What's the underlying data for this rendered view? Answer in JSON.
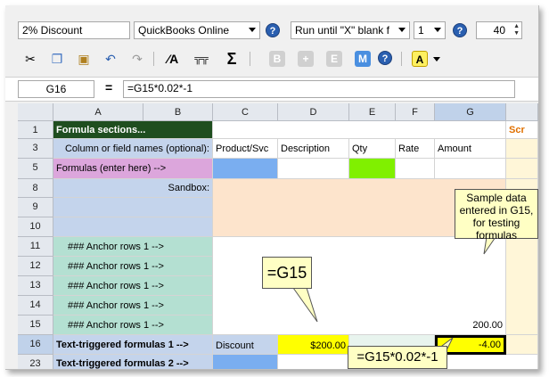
{
  "toolbar1": {
    "preset": "2% Discount",
    "app": "QuickBooks Online",
    "run_mode": "Run until \"X\" blank f",
    "count": "1",
    "zoom": "40"
  },
  "toolbar2": {
    "btn_b": "B",
    "btn_plus": "+",
    "btn_e": "E",
    "btn_m": "M",
    "btn_a": "A"
  },
  "formula_bar": {
    "cell": "G16",
    "eq": "=",
    "formula": "=G15*0.02*-1"
  },
  "columns": [
    "A",
    "B",
    "C",
    "D",
    "E",
    "F",
    "G"
  ],
  "rows": [
    "1",
    "3",
    "5",
    "8",
    "9",
    "10",
    "11",
    "12",
    "13",
    "14",
    "15",
    "16",
    "23"
  ],
  "cells": {
    "r1_a": "Formula sections...",
    "r1_h": "Scr",
    "r3_ab": "Column or field names  (optional):",
    "r3_c": "Product/Svc",
    "r3_d": "Description",
    "r3_e": "Qty",
    "r3_f": "Rate",
    "r3_g": "Amount",
    "r5_ab": "Formulas (enter here) -->",
    "r8_ab": "Sandbox:",
    "anchor": "###  Anchor rows 1 -->",
    "r15_g": "200.00",
    "r16_ab": "Text-triggered formulas 1 -->",
    "r16_c": "Discount",
    "r16_d": "$200.00",
    "r16_g": "-4.00",
    "r23_ab": "Text-triggered formulas 2 -->"
  },
  "callouts": {
    "sample": "Sample data entered in G15, for testing formulas",
    "g15": "=G15",
    "g16": "=G15*0.02*-1"
  },
  "colors": {
    "dark_green": "#1f4e1f",
    "light_blue": "#c4d4ec",
    "pink": "#dca6dc",
    "teal": "#b4e0d2",
    "peach": "#fde4cc",
    "yellow": "#ffff00",
    "lime": "#80f000",
    "callout": "#ffffc4"
  }
}
